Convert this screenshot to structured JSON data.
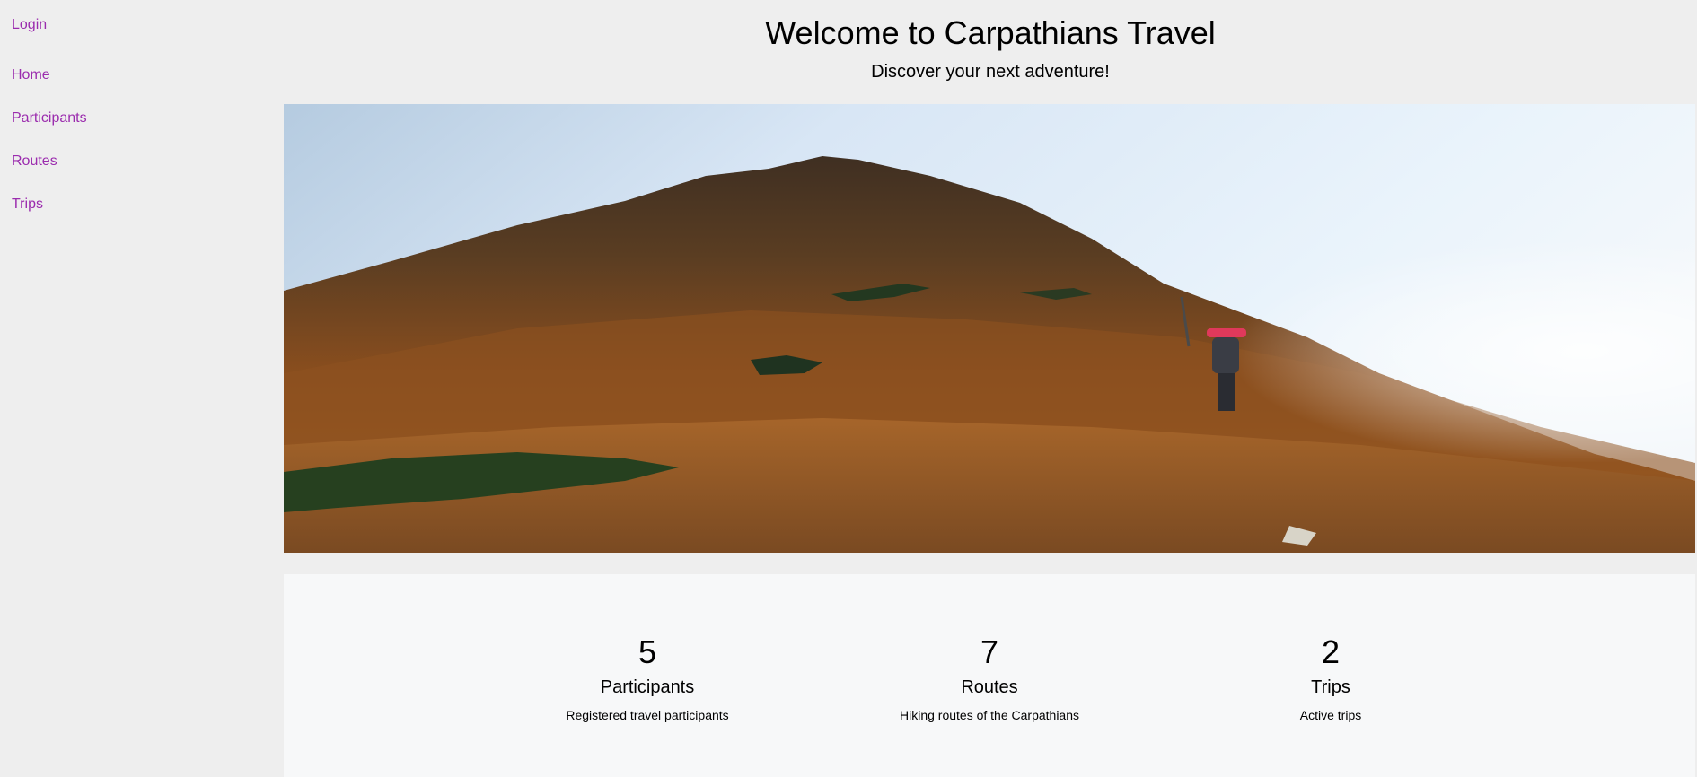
{
  "nav": {
    "login": "Login",
    "items": [
      "Home",
      "Participants",
      "Routes",
      "Trips"
    ]
  },
  "header": {
    "title": "Welcome to Carpathians Travel",
    "subtitle": "Discover your next adventure!"
  },
  "stats": [
    {
      "value": "5",
      "label": "Participants",
      "description": "Registered travel participants"
    },
    {
      "value": "7",
      "label": "Routes",
      "description": "Hiking routes of the Carpathians"
    },
    {
      "value": "2",
      "label": "Trips",
      "description": "Active trips"
    }
  ],
  "colors": {
    "link": "#9b2cae",
    "page_background": "#eeeeee",
    "stats_background": "#f7f8f9"
  }
}
